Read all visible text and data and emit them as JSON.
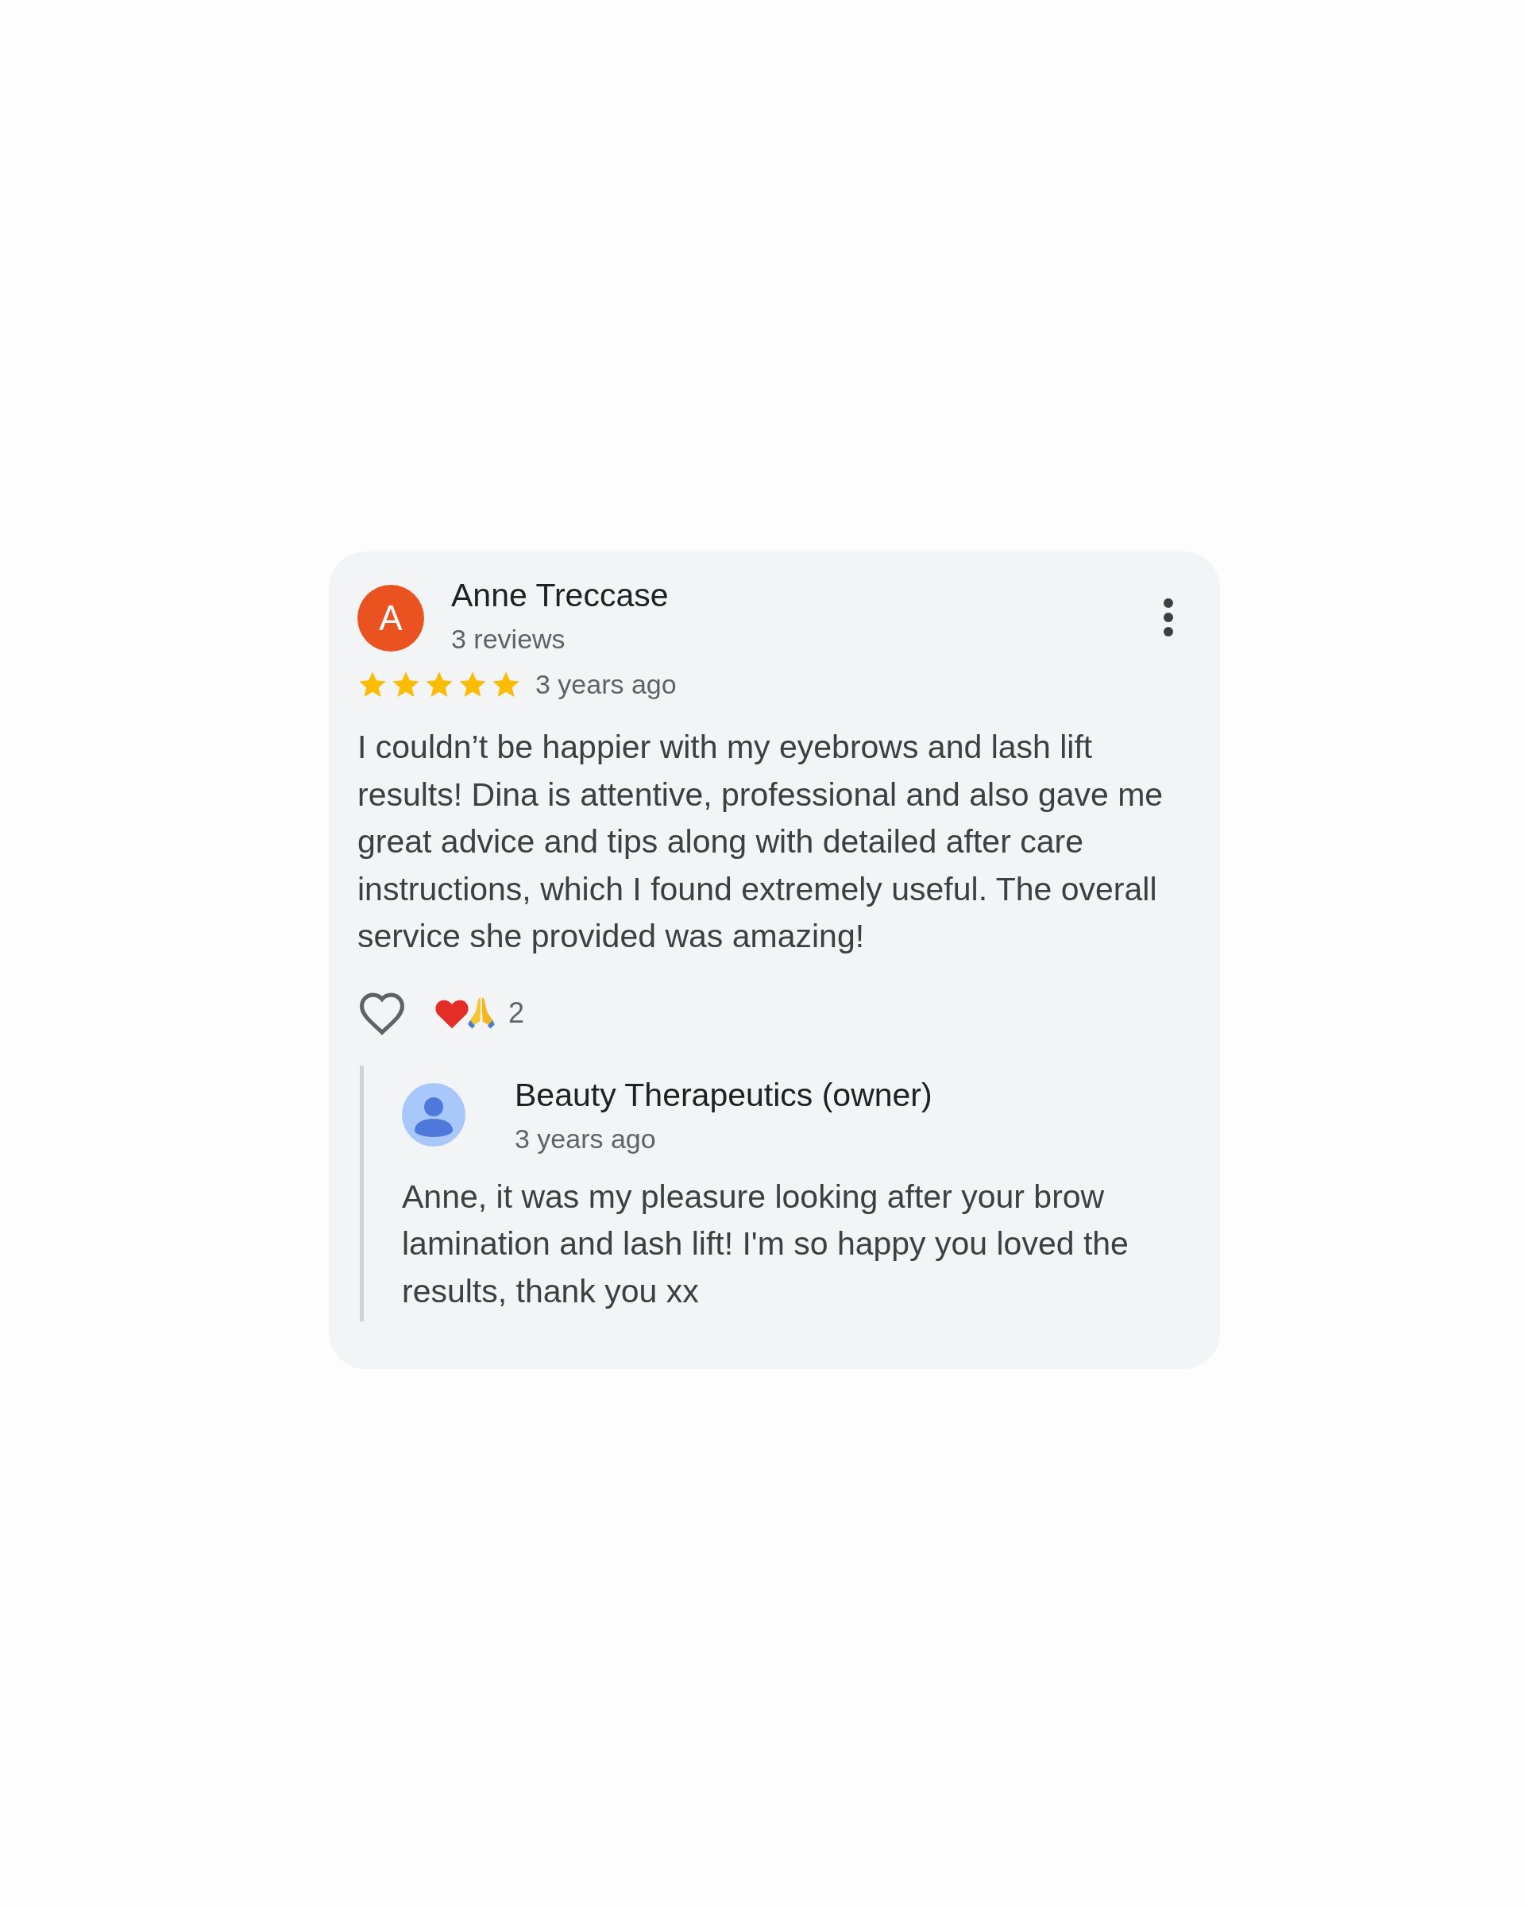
{
  "review": {
    "avatar_letter": "A",
    "author": "Anne Treccase",
    "author_meta": "3 reviews",
    "stars": 5,
    "time": "3 years ago",
    "text": "I couldn’t be happier with my eyebrows and lash lift results! Dina is attentive, professional and also gave me great advice and tips along with detailed after care instructions, which I found extremely useful. The overall service she provided was amazing!",
    "liked": false,
    "reaction_count": "2"
  },
  "owner_reply": {
    "author": "Beauty Therapeutics (owner)",
    "time": "3 years ago",
    "text": "Anne, it was my pleasure looking after your brow lamination and lash lift! I'm so happy you loved the results, thank you xx"
  }
}
